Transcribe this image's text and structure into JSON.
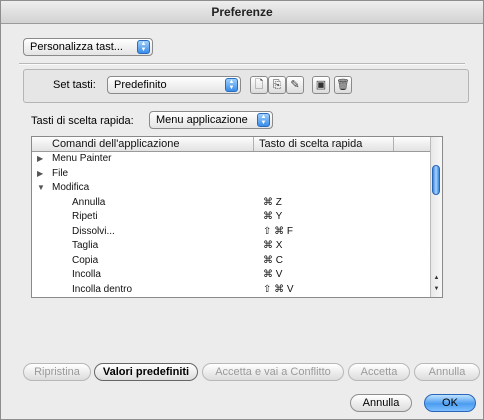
{
  "window": {
    "title": "Preferenze"
  },
  "top_popup": {
    "value": "Personalizza tast..."
  },
  "keyset": {
    "label": "Set tasti:",
    "value": "Predefinito",
    "tool_icons": [
      "new-set-icon",
      "duplicate-set-icon",
      "rename-set-icon",
      "save-set-icon",
      "delete-set-icon"
    ]
  },
  "shortcuts": {
    "label": "Tasti di scelta rapida:",
    "value": "Menu applicazione"
  },
  "table": {
    "headers": [
      "Comandi dell'applicazione",
      "Tasto di scelta rapida"
    ],
    "rows": [
      {
        "name": "Menu Painter",
        "shortcut": "",
        "level": 0,
        "expander": "▶"
      },
      {
        "name": "File",
        "shortcut": "",
        "level": 0,
        "expander": "▶"
      },
      {
        "name": "Modifica",
        "shortcut": "",
        "level": 0,
        "expander": "▼"
      },
      {
        "name": "Annulla",
        "shortcut": "⌘ Z",
        "level": 1,
        "expander": ""
      },
      {
        "name": "Ripeti",
        "shortcut": "⌘ Y",
        "level": 1,
        "expander": ""
      },
      {
        "name": "Dissolvi...",
        "shortcut": "⇧ ⌘ F",
        "level": 1,
        "expander": ""
      },
      {
        "name": "Taglia",
        "shortcut": "⌘ X",
        "level": 1,
        "expander": ""
      },
      {
        "name": "Copia",
        "shortcut": "⌘ C",
        "level": 1,
        "expander": ""
      },
      {
        "name": "Incolla",
        "shortcut": "⌘ V",
        "level": 1,
        "expander": ""
      },
      {
        "name": "Incolla dentro",
        "shortcut": "⇧ ⌘ V",
        "level": 1,
        "expander": ""
      }
    ]
  },
  "action_buttons": {
    "restore": "Ripristina",
    "defaults": "Valori predefiniti",
    "accept_conflict": "Accetta e vai a Conflitto",
    "accept": "Accetta",
    "cancel": "Annulla"
  },
  "dialog_buttons": {
    "cancel": "Annulla",
    "ok": "OK"
  }
}
